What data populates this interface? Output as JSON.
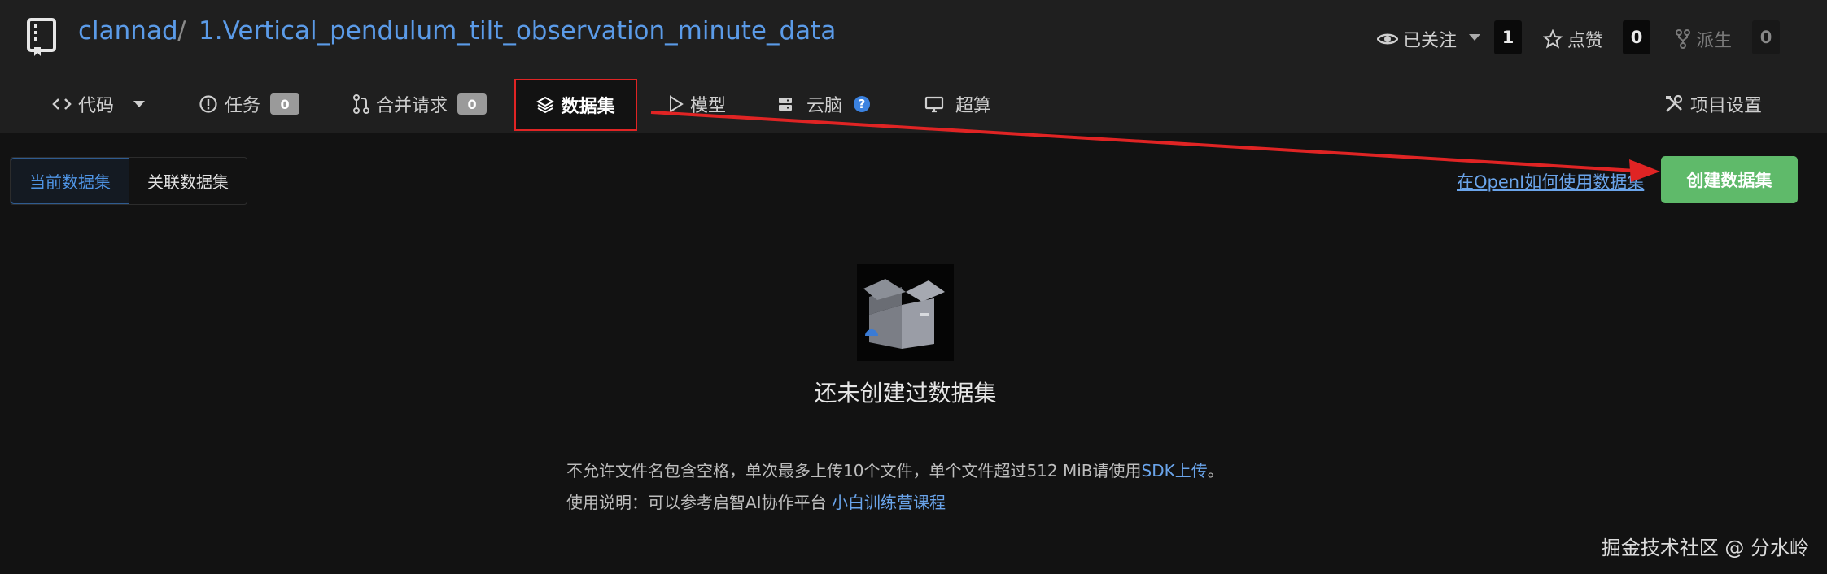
{
  "repo": {
    "owner": "clannad",
    "separator": "/",
    "name": "1.Vertical_pendulum_tilt_observation_minute_data"
  },
  "actions": {
    "watch": {
      "label": "已关注",
      "count": "1"
    },
    "star": {
      "label": "点赞",
      "count": "0"
    },
    "fork": {
      "label": "派生",
      "count": "0"
    }
  },
  "tabs": [
    {
      "label": "代码"
    },
    {
      "label": "任务",
      "badge": "0"
    },
    {
      "label": "合并请求",
      "badge": "0"
    },
    {
      "label": "数据集"
    },
    {
      "label": "模型"
    },
    {
      "label": "云脑"
    },
    {
      "label": "超算"
    }
  ],
  "settings_label": "项目设置",
  "segment": {
    "current": "当前数据集",
    "related": "关联数据集"
  },
  "howto_link": "在OpenI如何使用数据集",
  "create_button": "创建数据集",
  "empty": {
    "title": "还未创建过数据集",
    "note1_prefix": "不允许文件名包含空格，单次最多上传10个文件，单个文件超过512 MiB请使用",
    "note1_link": "SDK上传",
    "note1_suffix": "。",
    "note2_prefix": "使用说明：可以参考启智AI协作平台",
    "note2_link": "小白训练营课程"
  },
  "watermark": "掘金技术社区 @ 分水岭",
  "colors": {
    "link": "#5b9be8",
    "create_button": "#5fba6a",
    "highlight": "#e02424"
  }
}
